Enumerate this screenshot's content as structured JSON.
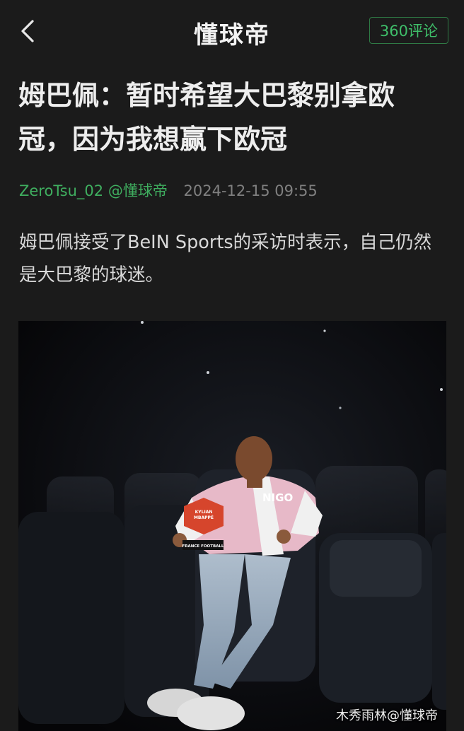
{
  "header": {
    "back_icon": "chevron-left-icon",
    "brand": "懂球帝",
    "comments_label": "360评论"
  },
  "article": {
    "title": "姆巴佩：暂时希望大巴黎别拿欧冠，因为我想赢下欧冠",
    "author": "ZeroTsu_02 @懂球帝",
    "date": "2024-12-15 09:55",
    "body": "姆巴佩接受了BeIN Sports的采访时表示，自己仍然是大巴黎的球迷。"
  },
  "photo": {
    "trophy_lines": [
      "KYLIAN",
      "MBAPPÉ"
    ],
    "trophy_base": "FRANCE FOOTBALL",
    "jacket_logo": "NIGO",
    "watermark": "木秀雨林@懂球帝"
  },
  "colors": {
    "background": "#1b1b1b",
    "accent_green": "#3fae5f",
    "meta_gray": "#808080"
  }
}
